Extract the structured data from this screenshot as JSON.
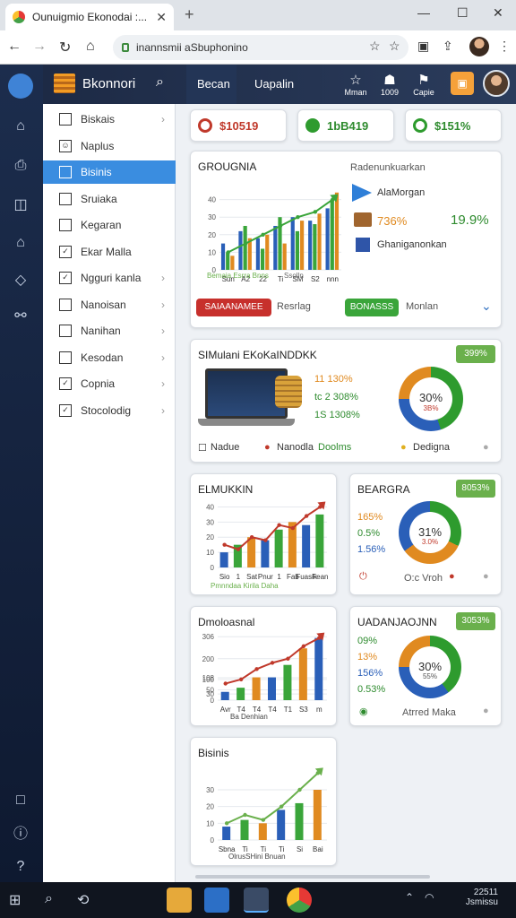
{
  "browser": {
    "tab_title": "Ounuigmio Ekonodai :...",
    "url": "inannsmii aSbuphonino"
  },
  "app": {
    "title": "Bkonnori",
    "header_tabs": [
      "Becan",
      "Uapalin"
    ],
    "header_icons": [
      {
        "label": "Mman",
        "icon": "star-icon"
      },
      {
        "label": "1009",
        "icon": "user-icon"
      },
      {
        "label": "Capie",
        "icon": "flag-icon"
      }
    ]
  },
  "sidebar": {
    "items": [
      {
        "label": "Biskais",
        "chevron": true,
        "active": false
      },
      {
        "label": "Naplus",
        "chevron": false,
        "active": false
      },
      {
        "label": "Bisinis",
        "chevron": false,
        "active": true
      },
      {
        "label": "Sruiaka",
        "chevron": false,
        "active": false
      },
      {
        "label": "Kegaran",
        "chevron": false,
        "active": false
      },
      {
        "label": "Ekar Malla",
        "chevron": false,
        "active": false
      },
      {
        "label": "Ngguri kanla",
        "chevron": true,
        "active": false
      },
      {
        "label": "Nanoisan",
        "chevron": true,
        "active": false
      },
      {
        "label": "Nanihan",
        "chevron": true,
        "active": false
      },
      {
        "label": "Kesodan",
        "chevron": true,
        "active": false
      },
      {
        "label": "Copnia",
        "chevron": true,
        "active": false
      },
      {
        "label": "Stocolodig",
        "chevron": true,
        "active": false
      }
    ]
  },
  "kpis": [
    {
      "value": "$10519",
      "color": "#c0392b"
    },
    {
      "value": "1bB419",
      "color": "#2e8b2e"
    },
    {
      "value": "$151%",
      "color": "#2e8b2e"
    }
  ],
  "growth_card": {
    "title": "GROUGNIA",
    "legend_text": "Bemaia Esrra Bnns",
    "legend_tail": "Ssolln",
    "right_title": "Radenunkuarkan",
    "right_item1": "AlaMorgan",
    "right_pct1": "736%",
    "right_pct2": "19.9%",
    "right_item2": "Ghaniganonkan",
    "btn_red": "SAIAANAMEE",
    "link1": "Resrlag",
    "btn_green": "BONASSS",
    "link2": "Monlan"
  },
  "simulation_card": {
    "title": "SIMulani EKoKaINDDKK",
    "pct1": "11 130%",
    "pct2": "tc 2 308%",
    "pct3": "1S 1308%",
    "donut_value": "30%",
    "donut_sub": "3B%",
    "footer1": "Nadue",
    "footer2": "Nanodla",
    "footer2b": "Doolms",
    "footer3": "Dedigna",
    "badge": "399%"
  },
  "card_elmukkin": {
    "title": "ELMUKKIN",
    "footer": "Pmnndaa Kirila Daha"
  },
  "card_beargra": {
    "title": "BEARGRA",
    "badge": "8053%",
    "lines": [
      "165%",
      "0.5%",
      "1.56%"
    ],
    "donut_value": "31%",
    "donut_sub": "3.0%",
    "footer": "O:c Vroh"
  },
  "card_dmodoasnal": {
    "title": "Dmoloasnal",
    "footer": "Ba Denhian"
  },
  "card_uadanjaojnn": {
    "title": "UADANJAOJNN",
    "badge": "3053%",
    "lines": [
      "09%",
      "13%",
      "156%",
      "0.53%"
    ],
    "donut_value": "30%",
    "donut_sub": "55%",
    "footer": "Atrred Maka"
  },
  "card_bisinis": {
    "title": "Bisinis",
    "footer": "OlrusSHini Bnuan"
  },
  "chart_data": [
    {
      "type": "bar",
      "title": "GROUGNIA",
      "categories": [
        "Sun",
        "A2",
        "22",
        "Ti",
        "SM",
        "S2",
        "nnn"
      ],
      "series": [
        {
          "values": [
            15,
            22,
            18,
            25,
            30,
            28,
            35
          ]
        },
        {
          "values": [
            10,
            25,
            12,
            30,
            22,
            26,
            40
          ]
        },
        {
          "values": [
            8,
            18,
            20,
            15,
            28,
            32,
            44
          ]
        }
      ],
      "line": [
        10,
        15,
        20,
        25,
        30,
        33,
        40
      ],
      "ylim": [
        0,
        50
      ],
      "yticks": [
        0,
        10,
        20,
        30,
        40
      ]
    },
    {
      "type": "bar",
      "title": "ELMUKKIN",
      "categories": [
        "Sio",
        "1",
        "Sat",
        "Pnur",
        "1",
        "Fab",
        "Fuasik",
        "Fean"
      ],
      "values": [
        10,
        15,
        20,
        18,
        25,
        30,
        28,
        35
      ],
      "line": [
        15,
        12,
        20,
        18,
        28,
        26,
        34,
        40
      ],
      "ylim": [
        0,
        45
      ],
      "yticks": [
        0,
        10,
        20,
        30,
        40
      ]
    },
    {
      "type": "bar",
      "title": "Dmoloasnal",
      "categories": [
        "Avr",
        "T4",
        "T4",
        "T4",
        "T1",
        "S3",
        "m"
      ],
      "values": [
        40,
        60,
        110,
        110,
        170,
        250,
        300
      ],
      "line": [
        80,
        100,
        150,
        180,
        200,
        260,
        300
      ],
      "ylim": [
        0,
        320
      ],
      "yticks": [
        0,
        30,
        50,
        100,
        108,
        200,
        306
      ]
    },
    {
      "type": "bar",
      "title": "Bisinis",
      "categories": [
        "Sbna",
        "Ti",
        "Ti",
        "Ti",
        "Si",
        "Bai"
      ],
      "values": [
        8,
        12,
        10,
        18,
        22,
        30
      ],
      "line": [
        10,
        15,
        12,
        20,
        30,
        40
      ],
      "ylim": [
        0,
        45
      ],
      "yticks": [
        0,
        10,
        20,
        30
      ]
    }
  ],
  "taskbar": {
    "time": "22511",
    "date": "Jsmissu"
  }
}
